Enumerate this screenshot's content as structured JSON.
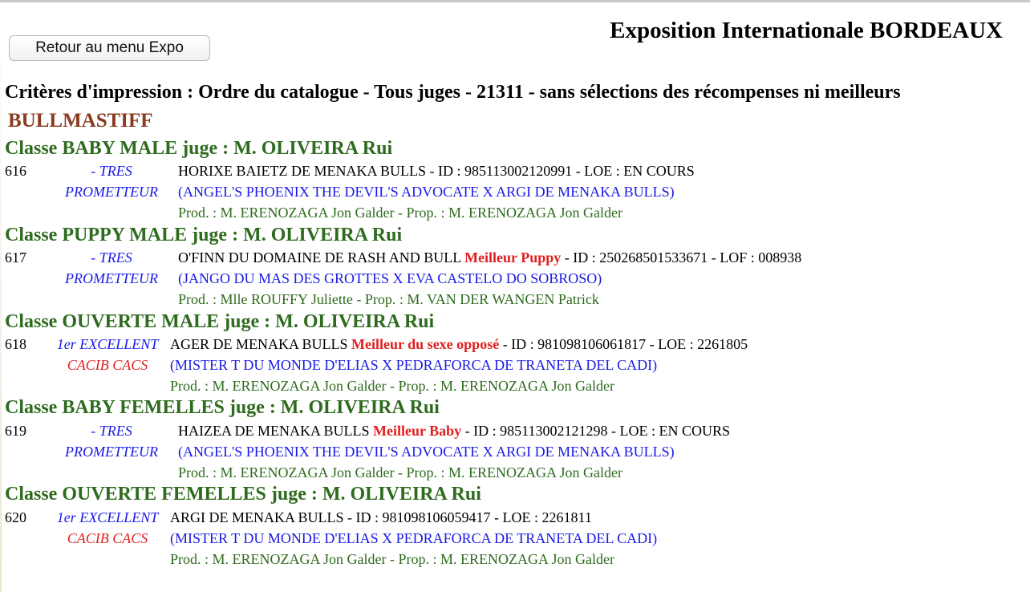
{
  "header": {
    "title": "Exposition Internationale BORDEAUX",
    "back_button": "Retour au menu Expo"
  },
  "criteria": "Critères d'impression : Ordre du catalogue - Tous juges - 21311 - sans sélections des récompenses ni meilleurs",
  "breed": "BULLMASTIFF",
  "colors": {
    "class_title": "#2e6b1e",
    "breed": "#8b3a1e",
    "award": "#e02020",
    "parents": "#1a1ae6",
    "producer": "#2e6b1e"
  },
  "classes": [
    {
      "title": "Classe BABY MALE juge : M. OLIVEIRA Rui",
      "entry": {
        "number": "616",
        "grade_line1": "- TRES",
        "grade_line2": "PROMETTEUR",
        "name": "HORIXE BAIETZ DE MENAKA BULLS ",
        "award": "",
        "id_text": " - ID : 985113002120991 - LOE : EN COURS",
        "parents": "(ANGEL'S PHOENIX THE DEVIL'S ADVOCATE X ARGI DE MENAKA BULLS)",
        "prod": "Prod. : M. ERENOZAGA Jon Galder - Prop. : M. ERENOZAGA Jon Galder"
      }
    },
    {
      "title": "Classe PUPPY MALE juge : M. OLIVEIRA Rui",
      "entry": {
        "number": "617",
        "grade_line1": "- TRES",
        "grade_line2": "PROMETTEUR",
        "name": "O'FINN DU DOMAINE DE RASH AND BULL ",
        "award": "Meilleur Puppy",
        "id_text": " - ID : 250268501533671 - LOF : 008938",
        "parents": "(JANGO DU MAS DES GROTTES X EVA CASTELO DO SOBROSO)",
        "prod": "Prod. : Mlle ROUFFY Juliette - Prop. : M. VAN DER WANGEN Patrick"
      }
    },
    {
      "title": "Classe OUVERTE MALE juge : M. OLIVEIRA Rui",
      "entry": {
        "number": "618",
        "grade_line1": "1er EXCELLENT",
        "grade_line2": "CACIB CACS",
        "name": "AGER DE MENAKA BULLS",
        "award": "Meilleur du sexe opposé",
        "id_text": " - ID : 981098106061817 - LOE : 2261805",
        "parents": "(MISTER T DU MONDE D'ELIAS X PEDRAFORCA DE TRANETA DEL CADI)",
        "prod": "Prod. : M. ERENOZAGA Jon Galder - Prop. : M. ERENOZAGA Jon Galder"
      }
    },
    {
      "title": "Classe BABY FEMELLES juge : M. OLIVEIRA Rui",
      "entry": {
        "number": "619",
        "grade_line1": "- TRES",
        "grade_line2": "PROMETTEUR",
        "name": "HAIZEA DE MENAKA BULLS ",
        "award": "Meilleur Baby",
        "id_text": " - ID : 985113002121298 - LOE : EN COURS",
        "parents": "(ANGEL'S PHOENIX THE DEVIL'S ADVOCATE X ARGI DE MENAKA BULLS)",
        "prod": "Prod. : M. ERENOZAGA Jon Galder - Prop. : M. ERENOZAGA Jon Galder"
      }
    },
    {
      "title": "Classe OUVERTE FEMELLES juge : M. OLIVEIRA Rui",
      "entry": {
        "number": "620",
        "grade_line1": "1er EXCELLENT",
        "grade_line2": "CACIB CACS",
        "name": "ARGI DE MENAKA BULLS ",
        "award": "",
        "id_text": " - ID : 981098106059417 - LOE : 2261811",
        "parents": "(MISTER T DU MONDE D'ELIAS X PEDRAFORCA DE TRANETA DEL CADI)",
        "prod": "Prod. : M. ERENOZAGA Jon Galder - Prop. : M. ERENOZAGA Jon Galder"
      }
    }
  ]
}
